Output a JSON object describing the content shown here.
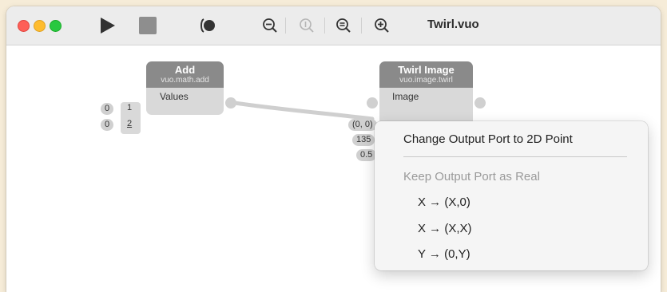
{
  "window": {
    "title": "Twirl.vuo"
  },
  "toolbar": {
    "run_icon": "play-icon",
    "stop_icon": "stop-icon",
    "show_events_icon": "show-events-icon",
    "zoom_out_icon": "zoom-out-icon",
    "zoom_actual_icon": "zoom-actual-icon",
    "zoom_fit_icon": "zoom-fit-icon",
    "zoom_in_icon": "zoom-in-icon"
  },
  "nodes": {
    "add": {
      "title": "Add",
      "class": "vuo.math.add",
      "input_label": "Values",
      "const_a": "0",
      "const_b": "0",
      "idx_1": "1",
      "idx_2": "2"
    },
    "twirl": {
      "title": "Twirl Image",
      "class": "vuo.image.twirl",
      "input_label": "Image",
      "const_center": "(0, 0)",
      "const_angle": "135",
      "const_radius": "0.5"
    }
  },
  "context_menu": {
    "items": [
      {
        "label": "Change Output Port to 2D Point",
        "enabled": true
      },
      {
        "label": "Keep Output Port as Real",
        "enabled": false
      },
      {
        "label": "X → (X,0)",
        "enabled": true
      },
      {
        "label": "X → (X,X)",
        "enabled": true
      },
      {
        "label": "Y → (0,Y)",
        "enabled": true
      }
    ]
  },
  "colors": {
    "node_header": "#8a8a8a",
    "node_body": "#d9d9d9",
    "cable": "#cfcfcf",
    "menu_bg": "#f5f5f5"
  }
}
